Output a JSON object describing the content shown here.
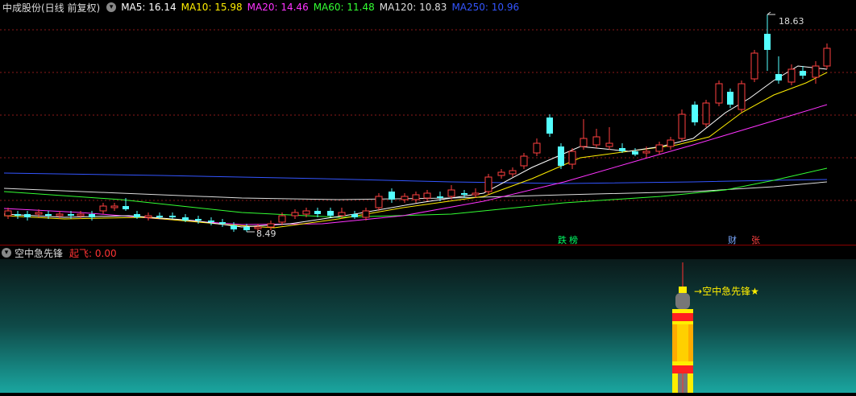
{
  "header": {
    "stock_title": "中成股份(日线 前复权)",
    "ma": [
      {
        "label": "MA5: 16.14",
        "color": "#ffffff"
      },
      {
        "label": "MA10: 15.98",
        "color": "#ffee00"
      },
      {
        "label": "MA20: 14.46",
        "color": "#ff33ff"
      },
      {
        "label": "MA60: 11.48",
        "color": "#33ff33"
      },
      {
        "label": "MA120: 10.83",
        "color": "#dddddd"
      },
      {
        "label": "MA250: 10.96",
        "color": "#3355ff"
      }
    ]
  },
  "chart": {
    "high_label": "18.63",
    "low_label": "8.49",
    "tags": {
      "die": "跌",
      "bang": "榜",
      "cai": "财",
      "zhang": "张"
    }
  },
  "indicator": {
    "name": "空中急先锋",
    "value_label": "起飞: 0.00",
    "signal_text": "空中急先锋★"
  },
  "colors": {
    "up": "#ff4040",
    "down": "#54ffff",
    "grid": "#8b0000"
  }
}
